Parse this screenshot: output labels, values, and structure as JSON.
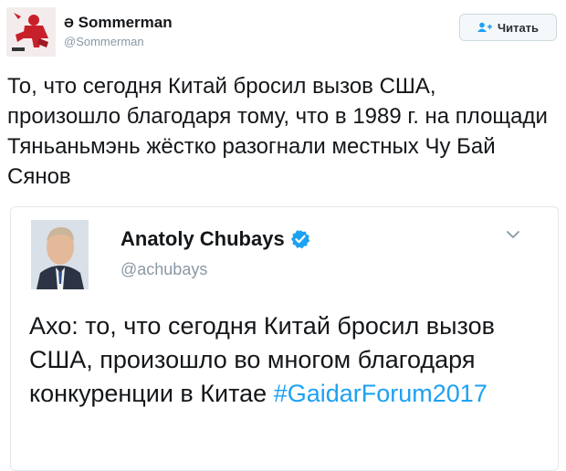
{
  "tweet": {
    "author": {
      "name": "Sommerman",
      "handle": "@Sommerman",
      "name_prefix_icon": "anarchy-symbol-icon"
    },
    "follow_button": {
      "label": "Читать",
      "icon": "follow-user-icon"
    },
    "text": "То, что сегодня Китай бросил вызов США, произошло благодаря тому, что в 1989 г. на площади Тяньаньмэнь жёстко разогнали местных Чу Бай Сянов"
  },
  "quoted_tweet": {
    "author": {
      "name": "Anatoly Chubays",
      "handle": "@achubays",
      "verified": true
    },
    "text": "Ахо: то, что сегодня Китай бросил вызов США, произошло во многом благодаря конкуренции в Китае",
    "hashtag": "#GaidarForum2017"
  },
  "colors": {
    "link": "#1da1f2",
    "muted": "#8899a6",
    "verified": "#1da1f2",
    "avatar_red": "#c8202a"
  }
}
